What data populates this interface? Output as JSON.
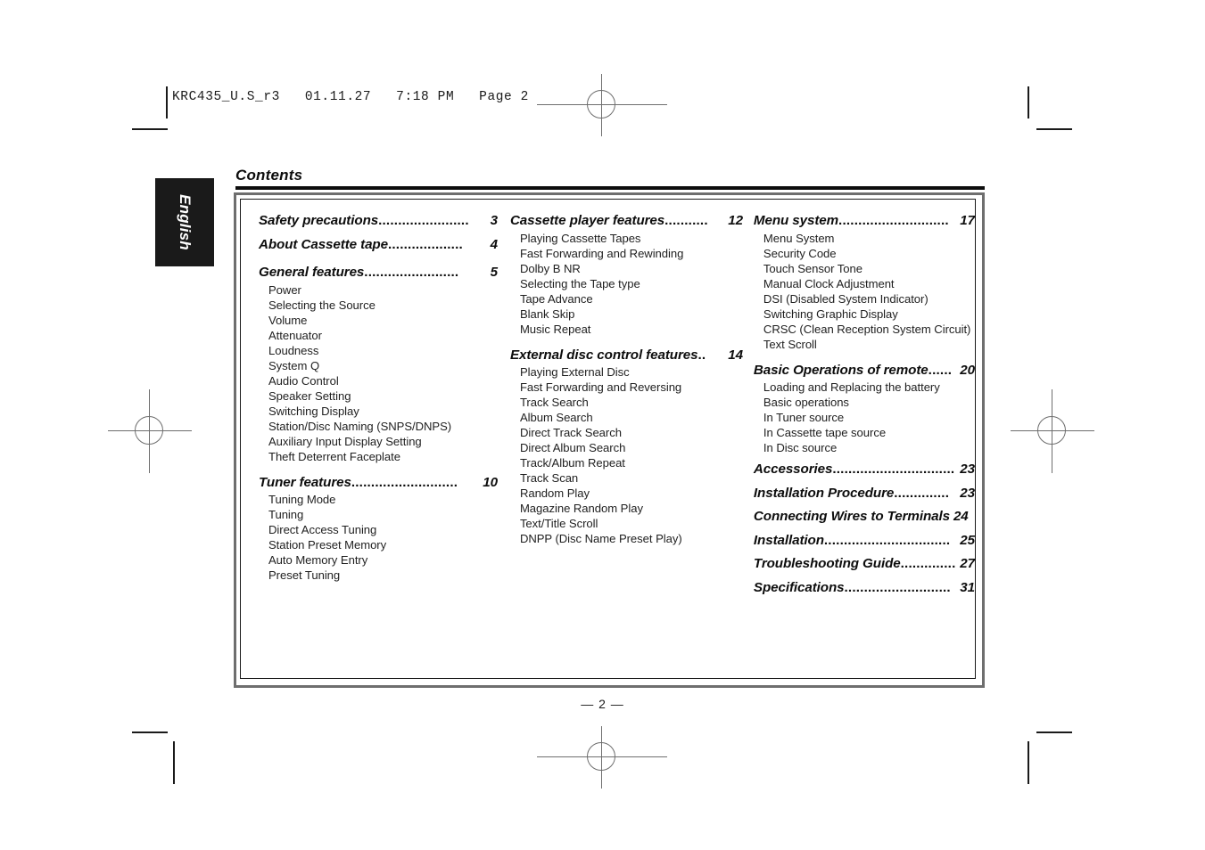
{
  "prepress": {
    "header": "KRC435_U.S_r3   01.11.27   7:18 PM   Page 2"
  },
  "language_tab": {
    "label": "English"
  },
  "page": {
    "title": "Contents",
    "folio": "— 2 —"
  },
  "columns": [
    {
      "blocks": [
        {
          "major": {
            "title": "Safety precautions",
            "page": "3",
            "leader": "......................."
          },
          "subs": []
        },
        {
          "major": {
            "title": "About Cassette tape",
            "page": "4",
            "leader": "..................."
          },
          "subs": []
        },
        {
          "major": {
            "title": "General features",
            "page": "5",
            "leader": "........................"
          },
          "subs": [
            "Power",
            "Selecting the Source",
            "Volume",
            "Attenuator",
            "Loudness",
            "System Q",
            "Audio Control",
            "Speaker Setting",
            "Switching Display",
            "Station/Disc Naming (SNPS/DNPS)",
            "Auxiliary Input Display Setting",
            "Theft Deterrent Faceplate"
          ]
        },
        {
          "major": {
            "title": "Tuner features",
            "page": "10",
            "leader": "..........................."
          },
          "subs": [
            "Tuning Mode",
            "Tuning",
            "Direct Access Tuning",
            "Station Preset Memory",
            "Auto Memory Entry",
            "Preset Tuning"
          ]
        }
      ]
    },
    {
      "blocks": [
        {
          "major": {
            "title": "Cassette player features",
            "page": "12",
            "leader": "..........."
          },
          "subs": [
            "Playing Cassette Tapes",
            "Fast Forwarding and Rewinding",
            "Dolby B NR",
            "Selecting the Tape type",
            "Tape Advance",
            "Blank Skip",
            "Music Repeat"
          ]
        },
        {
          "major": {
            "title": "External disc control features",
            "page": "14",
            "leader": ".."
          },
          "subs": [
            "Playing External Disc",
            "Fast Forwarding and Reversing",
            "Track Search",
            "Album Search",
            "Direct Track Search",
            "Direct Album Search",
            "Track/Album Repeat",
            "Track Scan",
            "Random Play",
            "Magazine Random Play",
            "Text/Title Scroll",
            "DNPP (Disc Name Preset Play)"
          ]
        }
      ]
    },
    {
      "blocks": [
        {
          "major": {
            "title": "Menu system",
            "page": "17",
            "leader": "............................"
          },
          "subs": [
            "Menu System",
            "Security Code",
            "Touch Sensor Tone",
            "Manual Clock Adjustment",
            "DSI (Disabled System Indicator)",
            "Switching Graphic Display",
            "CRSC (Clean Reception System Circuit)",
            "Text Scroll"
          ]
        },
        {
          "major": {
            "title": "Basic Operations of remote",
            "page": "20",
            "leader": "......"
          },
          "subs": [
            "Loading and Replacing the battery",
            "Basic operations",
            "In Tuner source",
            "In Cassette tape source",
            "In Disc source"
          ]
        },
        {
          "major": {
            "title": "Accessories",
            "page": "23",
            "leader": "..............................."
          },
          "subs": []
        },
        {
          "major": {
            "title": "Installation Procedure",
            "page": "23",
            "leader": ".............."
          },
          "subs": []
        },
        {
          "major": {
            "title": "Connecting Wires to Terminals",
            "page": "24",
            "leader": ""
          },
          "subs": []
        },
        {
          "major": {
            "title": "Installation",
            "page": "25",
            "leader": "................................"
          },
          "subs": []
        },
        {
          "major": {
            "title": "Troubleshooting Guide",
            "page": "27",
            "leader": ".............."
          },
          "subs": []
        },
        {
          "major": {
            "title": "Specifications",
            "page": "31",
            "leader": "..........................."
          },
          "subs": []
        }
      ]
    }
  ]
}
